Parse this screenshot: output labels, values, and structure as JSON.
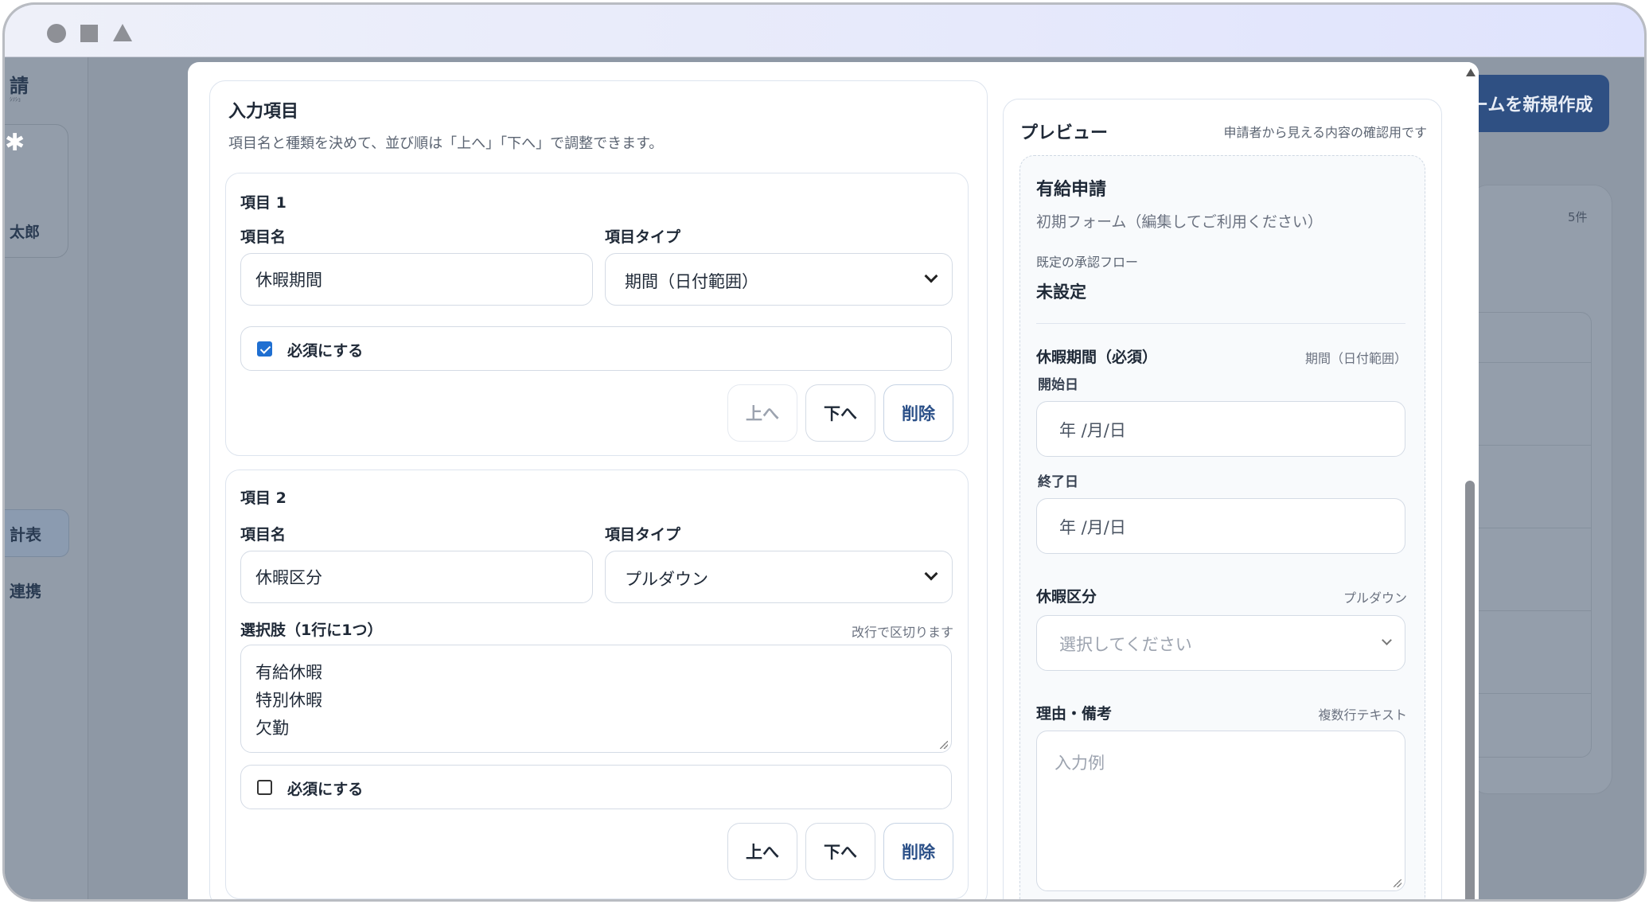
{
  "background": {
    "brand": "請",
    "brand_sub": "ｼｿｼｮ",
    "user_name": "太郎",
    "nav_1": "計表",
    "nav_2": "連携",
    "new_button": "ームを新規作成",
    "count": "5件"
  },
  "section": {
    "title": "入力項目",
    "description": "項目名と種類を決めて、並び順は「上へ」「下へ」で調整できます。"
  },
  "labels": {
    "name": "項目名",
    "type": "項目タイプ",
    "required": "必須にする",
    "up": "上へ",
    "down": "下へ",
    "delete": "削除"
  },
  "items": [
    {
      "title": "項目 1",
      "name_value": "休暇期間",
      "type_value": "期間（日付範囲）",
      "required": true,
      "up_disabled": true
    },
    {
      "title": "項目 2",
      "name_value": "休暇区分",
      "type_value": "プルダウン",
      "choices_label": "選択肢（1行に1つ）",
      "choices_hint": "改行で区切ります",
      "choices": [
        "有給休暇",
        "特別休暇",
        "欠勤"
      ],
      "required": false,
      "up_disabled": false
    }
  ],
  "preview": {
    "title": "プレビュー",
    "subtitle": "申請者から見える内容の確認用です",
    "form_name": "有給申請",
    "form_description": "初期フォーム（編集してご利用ください）",
    "flow_label": "既定の承認フロー",
    "flow_value": "未設定",
    "fields": [
      {
        "label": "休暇期間（必須）",
        "type": "期間（日付範囲）",
        "start_label": "開始日",
        "end_label": "終了日",
        "date_placeholder": "年 /月/日"
      },
      {
        "label": "休暇区分",
        "type": "プルダウン",
        "placeholder": "選択してください"
      },
      {
        "label": "理由・備考",
        "type": "複数行テキスト",
        "placeholder": "入力例"
      }
    ]
  }
}
